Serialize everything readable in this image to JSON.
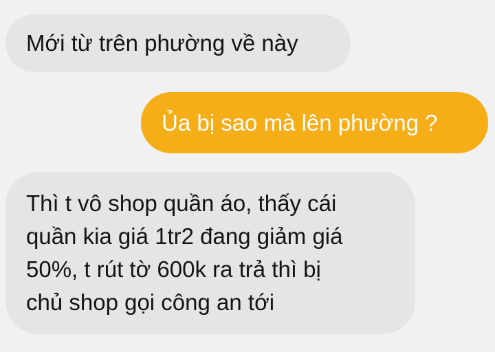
{
  "messages": [
    {
      "direction": "incoming",
      "text": "Mới từ trên phường về này"
    },
    {
      "direction": "outgoing",
      "text": "Ủa bị sao mà lên phường ?"
    },
    {
      "direction": "incoming",
      "text": "Thì t vô shop quần áo, thấy cái\nquần kia giá 1tr2 đang giảm giá\n50%, t rút tờ 600k ra trả thì bị\nchủ shop gọi công an tới"
    }
  ],
  "colors": {
    "background": "#f1f1f1",
    "incoming_bubble": "#e5e5e6",
    "outgoing_bubble": "#f5ae17",
    "incoming_text": "#141414",
    "outgoing_text": "#fdfdfd"
  }
}
